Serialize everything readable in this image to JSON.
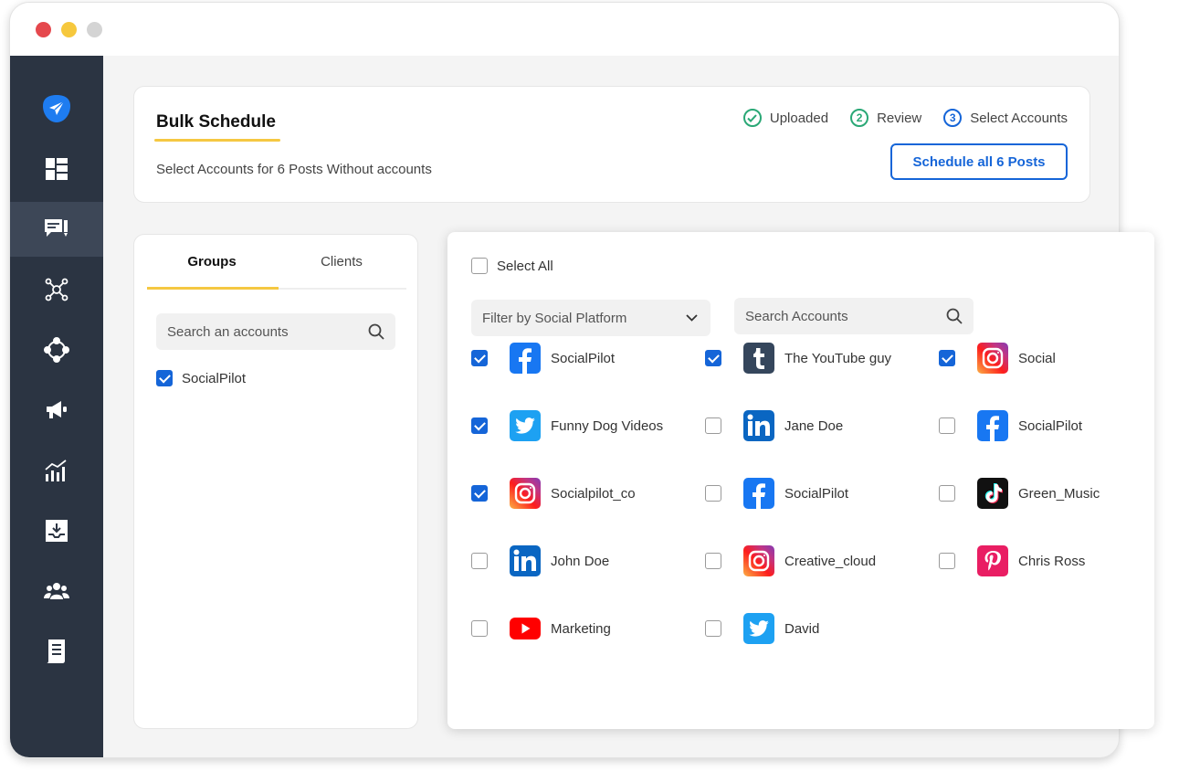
{
  "window": {
    "controls": [
      "close",
      "minimize",
      "zoom"
    ]
  },
  "sidebar": {
    "items": [
      {
        "name": "send-icon",
        "active": false
      },
      {
        "name": "dashboard-icon",
        "active": false
      },
      {
        "name": "posts-icon",
        "active": true
      },
      {
        "name": "connections-icon",
        "active": false
      },
      {
        "name": "network-icon",
        "active": false
      },
      {
        "name": "megaphone-icon",
        "active": false
      },
      {
        "name": "analytics-icon",
        "active": false
      },
      {
        "name": "inbox-icon",
        "active": false
      },
      {
        "name": "team-icon",
        "active": false
      },
      {
        "name": "reports-icon",
        "active": false
      }
    ]
  },
  "header": {
    "title": "Bulk Schedule",
    "subtitle": "Select Accounts for 6 Posts Without accounts",
    "steps": [
      {
        "label": "Uploaded",
        "marker": "check",
        "state": "done"
      },
      {
        "label": "Review",
        "marker": "2",
        "state": "done"
      },
      {
        "label": "Select Accounts",
        "marker": "3",
        "state": "current"
      }
    ],
    "schedule_button": "Schedule all 6 Posts"
  },
  "groups_panel": {
    "tabs": [
      {
        "label": "Groups",
        "active": true
      },
      {
        "label": "Clients",
        "active": false
      }
    ],
    "search_placeholder": "Search an accounts",
    "items": [
      {
        "label": "SocialPilot",
        "checked": true
      }
    ]
  },
  "accounts_panel": {
    "select_all_label": "Select All",
    "select_all_checked": false,
    "filter_label": "Filter by Social Platform",
    "search_placeholder": "Search Accounts",
    "accounts": [
      {
        "name": "SocialPilot",
        "platform": "facebook",
        "checked": true
      },
      {
        "name": "The YouTube guy",
        "platform": "tumblr",
        "checked": true
      },
      {
        "name": "Social",
        "platform": "instagram",
        "checked": true
      },
      {
        "name": "Funny Dog Videos",
        "platform": "twitter",
        "checked": true
      },
      {
        "name": "Jane Doe",
        "platform": "linkedin",
        "checked": false
      },
      {
        "name": "SocialPilot",
        "platform": "facebook",
        "checked": false
      },
      {
        "name": "Socialpilot_co",
        "platform": "instagram",
        "checked": true
      },
      {
        "name": "SocialPilot",
        "platform": "facebook",
        "checked": false
      },
      {
        "name": "Green_Music",
        "platform": "tiktok",
        "checked": false
      },
      {
        "name": "John Doe",
        "platform": "linkedin",
        "checked": false
      },
      {
        "name": "Creative_cloud",
        "platform": "instagram",
        "checked": false
      },
      {
        "name": "Chris Ross",
        "platform": "pinterest",
        "checked": false
      },
      {
        "name": "Marketing",
        "platform": "youtube",
        "checked": false
      },
      {
        "name": "David",
        "platform": "twitter",
        "checked": false
      }
    ]
  },
  "colors": {
    "sidebar": "#2b3442",
    "sidebar_active": "#3d4757",
    "primary": "#1565d8",
    "accent_underline": "#f5c842",
    "step_done": "#2aa876",
    "facebook": "#1877f2",
    "twitter": "#1da1f2",
    "linkedin": "#0a66c2",
    "tumblr": "#35465c",
    "pinterest": "#e60023",
    "youtube": "#ff0000",
    "tiktok": "#111111"
  }
}
